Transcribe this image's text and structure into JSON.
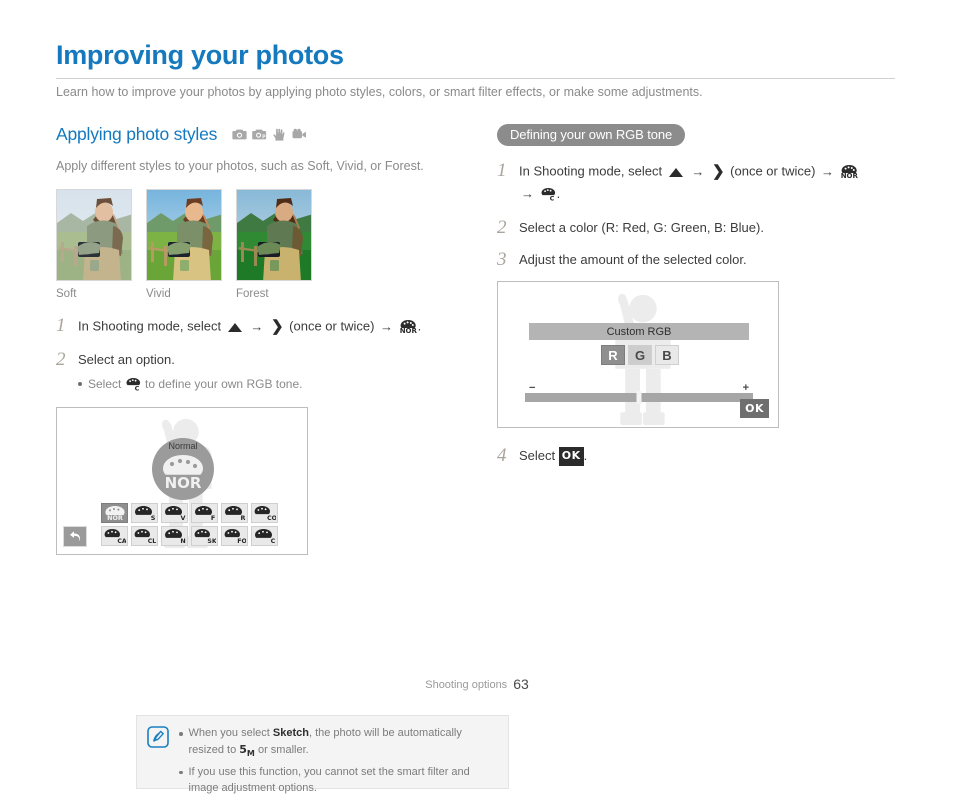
{
  "page": {
    "title": "Improving your photos",
    "intro": "Learn how to improve your photos by applying photo styles, colors, or smart filter effects, or make some adjustments.",
    "accent_color": "#1479be",
    "footer_label": "Shooting options",
    "footer_page": "63"
  },
  "left": {
    "section_title": "Applying photo styles",
    "mode_icons": [
      "camera-icon",
      "camera-program-icon",
      "dual-is-icon",
      "camcorder-icon"
    ],
    "lead": "Apply different styles to your photos, such as Soft, Vivid, or Forest.",
    "thumbnails": [
      {
        "label": "Soft",
        "style": "soft"
      },
      {
        "label": "Vivid",
        "style": "vivid"
      },
      {
        "label": "Forest",
        "style": "forest"
      }
    ],
    "steps": [
      {
        "num": "1",
        "text_before": "In Shooting mode, select",
        "mid": "(once or twice)",
        "text_after": "."
      },
      {
        "num": "2",
        "text": "Select an option.",
        "sub_before": "Select",
        "sub_after": "to define your own RGB tone."
      }
    ],
    "screen": {
      "circle_label": "Normal",
      "circle_glyph": "NOR",
      "back_button": "back-arrow",
      "grid_row1": [
        "NOR",
        "S",
        "V",
        "F",
        "R",
        "CO"
      ],
      "grid_row2": [
        "CA",
        "CL",
        "N",
        "SK",
        "FO",
        "C"
      ],
      "selected": "NOR"
    },
    "note": {
      "icon": "note-pen-icon",
      "items": [
        {
          "before": "When you select",
          "bold": "Sketch",
          "after": ", the photo will be automatically resized to",
          "glyph": "5M",
          "tail": "or smaller."
        },
        {
          "before": "If you use this function, you cannot set the smart filter and image adjustment options.",
          "bold": "",
          "after": "",
          "glyph": "",
          "tail": ""
        }
      ]
    }
  },
  "right": {
    "pill": "Defining your own RGB tone",
    "steps": [
      {
        "num": "1",
        "text_before": "In Shooting mode, select",
        "mid": "(once or twice)",
        "text_after": "."
      },
      {
        "num": "2",
        "text": "Select a color (R: Red, G: Green, B: Blue)."
      },
      {
        "num": "3",
        "text": "Adjust the amount of the selected color."
      },
      {
        "num": "4",
        "text_before": "Select",
        "ok": "OK",
        "text_after": "."
      }
    ],
    "screen": {
      "title": "Custom RGB",
      "buttons": [
        "R",
        "G",
        "B"
      ],
      "selected_button": "R",
      "slider_minus": "−",
      "slider_plus": "+",
      "ok_label": "OK"
    }
  }
}
